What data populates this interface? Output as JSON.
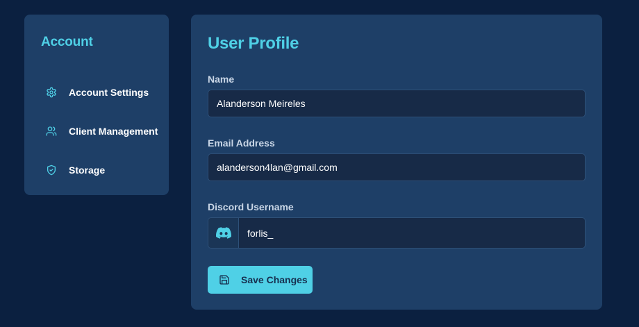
{
  "sidebar": {
    "title": "Account",
    "items": [
      {
        "label": "Account Settings",
        "icon": "gear-icon"
      },
      {
        "label": "Client Management",
        "icon": "users-icon"
      },
      {
        "label": "Storage",
        "icon": "shield-icon"
      }
    ]
  },
  "main": {
    "title": "User Profile",
    "fields": {
      "name": {
        "label": "Name",
        "value": "Alanderson Meireles"
      },
      "email": {
        "label": "Email Address",
        "value": "alanderson4lan@gmail.com"
      },
      "discord": {
        "label": "Discord Username",
        "value": "forlis_",
        "icon": "discord-icon"
      }
    },
    "save_button": {
      "label": "Save Changes",
      "icon": "save-icon"
    }
  },
  "colors": {
    "background": "#0b2040",
    "panel": "#1e3f67",
    "accent": "#4fd0e6",
    "input_bg": "#172a47"
  }
}
